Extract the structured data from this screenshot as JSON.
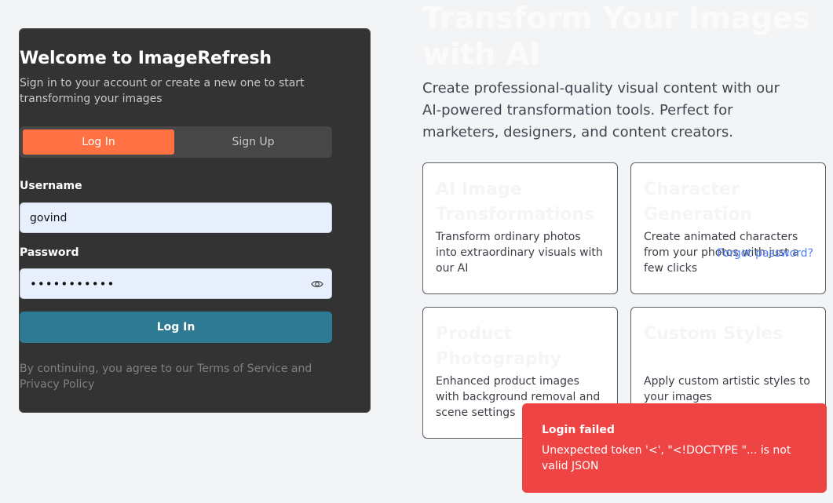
{
  "login_card": {
    "title": "Welcome to ImageRefresh",
    "subtitle": "Sign in to your account or create a new one to start transforming your images",
    "tabs": [
      {
        "label": "Log In",
        "active": true
      },
      {
        "label": "Sign Up",
        "active": false
      }
    ],
    "username_label": "Username",
    "username_value": "govind",
    "password_label": "Password",
    "password_value": "•••••••••••",
    "forgot_password": "Forgot password?",
    "submit_label": "Log In",
    "terms": "By continuing, you agree to our Terms of Service and Privacy Policy"
  },
  "hero": {
    "title": "Transform Your Images with AI",
    "description": "Create professional-quality visual content with our AI-powered transformation tools. Perfect for marketers, designers, and content creators.",
    "features": [
      {
        "title": "AI Image Transformations",
        "description": "Transform ordinary photos into extraordinary visuals with our AI"
      },
      {
        "title": "Character Generation",
        "description": "Create animated characters from your photos with just a few clicks"
      },
      {
        "title": "Product Photography",
        "description": "Enhanced product images with background removal and scene settings"
      },
      {
        "title": "Custom Styles",
        "description": "Apply custom artistic styles to your images"
      }
    ]
  },
  "toast": {
    "title": "Login failed",
    "message": "Unexpected token '<', \"<!DOCTYPE \"... is not valid JSON"
  },
  "colors": {
    "accent_orange": "#ff7043",
    "button_teal": "#2e7a93",
    "link_blue": "#4f7cff",
    "error_red": "#ef4444"
  },
  "icons": {
    "password_toggle": "eye-icon"
  }
}
